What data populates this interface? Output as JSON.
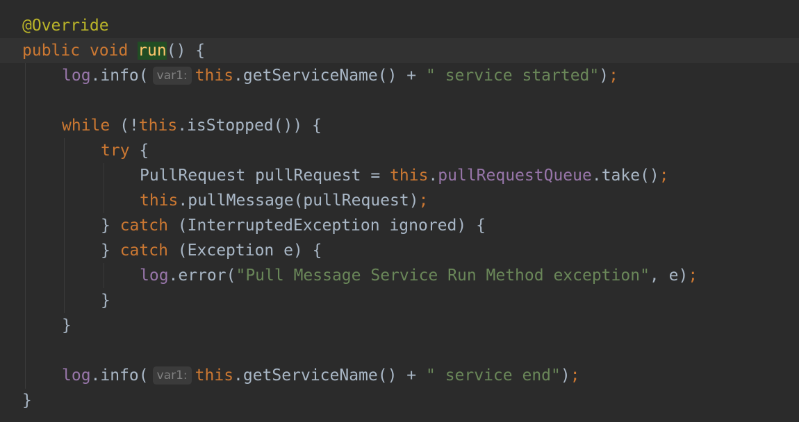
{
  "code": {
    "annotation": "@Override",
    "kw_public": "public",
    "kw_void": "void",
    "method_name": "run",
    "sig_tail": "() {",
    "kw_this": "this",
    "log_ident": "log",
    "info_call": ".info(",
    "hint_label": "var1:",
    "get_service_name": ".getServiceName() + ",
    "str_started": "\" service started\"",
    "close_paren": ")",
    "semicolon": ";",
    "kw_while": "while",
    "while_open": " (!",
    "is_stopped": ".isStopped()) {",
    "kw_try": "try",
    "try_brace": " {",
    "pull_decl": "PullRequest pullRequest = ",
    "dot": ".",
    "queue_field": "pullRequestQueue",
    "take_call": ".take()",
    "pull_message_call": ".pullMessage(pullRequest)",
    "close_brace_space": "} ",
    "kw_catch": "catch",
    "catch_interrupted": " (InterruptedException ignored) {",
    "catch_exception": " (Exception e) {",
    "error_call": ".error(",
    "str_error": "\"Pull Message Service Run Method exception\"",
    "error_tail": ", e)",
    "close_brace": "}",
    "str_end": "\" service end\""
  }
}
